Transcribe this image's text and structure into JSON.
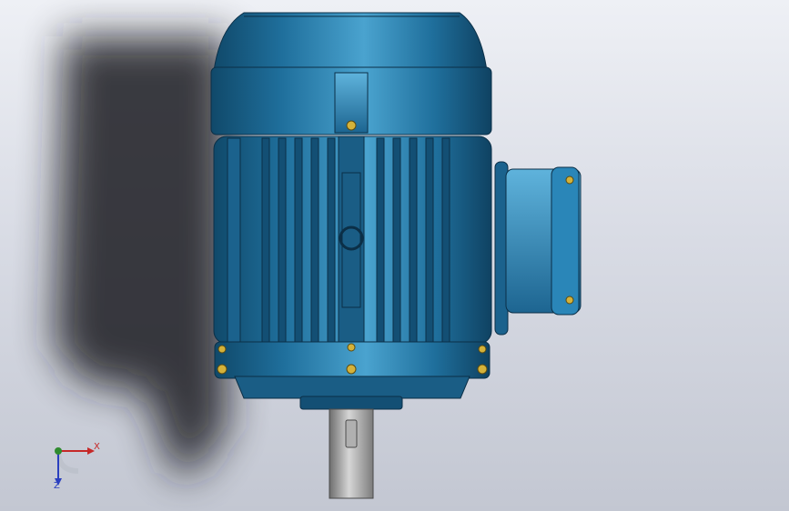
{
  "viewport": {
    "background_top": "#eef0f5",
    "background_bottom": "#c3c7d2"
  },
  "model": {
    "part": "electric-motor",
    "body_color": "#1f6f9c",
    "highlight_color": "#4aa3cf",
    "shaft_color": "#8c8c8c",
    "bolt_color": "#d4b23a"
  },
  "triad": {
    "x_label": "X",
    "z_label": "Z",
    "x_color": "#c62828",
    "y_color": "#2e8b2e",
    "z_color": "#2a3fbf"
  }
}
